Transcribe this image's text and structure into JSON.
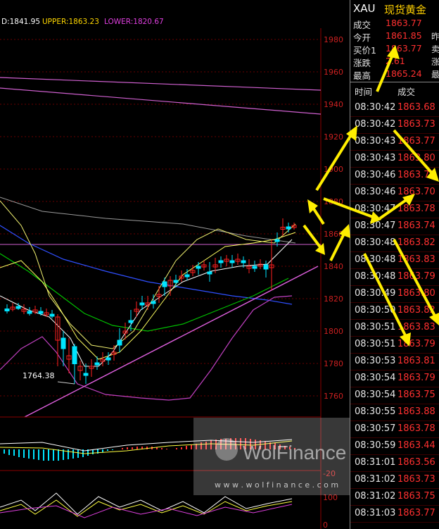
{
  "indicator": {
    "mid_label": "D:1841.95",
    "upper_label": "UPPER:1863.23",
    "lower_label": "LOWER:1820.67",
    "low_marker": "1764.38"
  },
  "axis_ticks": [
    "1980",
    "1960",
    "1940",
    "1920",
    "1900",
    "1880",
    "1860",
    "1840",
    "1820",
    "1800",
    "1780",
    "1760"
  ],
  "lower_ticks": [
    "-20",
    "100",
    "0"
  ],
  "watermark": {
    "brand": "WolFinance",
    "url": "w w w . w o l f i n a n c e . c o m"
  },
  "quote": {
    "symbol": "XAU",
    "name": "现货黄金",
    "rows": [
      {
        "label": "成交",
        "value": "1863.77",
        "edge": ""
      },
      {
        "label": "今开",
        "value": "1861.85",
        "edge": "昨"
      },
      {
        "label": "买价1",
        "value": "1863.77",
        "edge": "卖"
      },
      {
        "label": "涨跌",
        "value": "2.61",
        "edge": "涨"
      },
      {
        "label": "最高",
        "value": "1865.24",
        "edge": "最"
      }
    ]
  },
  "ticks": {
    "col_time": "时间",
    "col_price": "成交",
    "rows": [
      {
        "time": "08:30:42",
        "price": "1863.68"
      },
      {
        "time": "08:30:42",
        "price": "1863.73"
      },
      {
        "time": "08:30:43",
        "price": "1863.77"
      },
      {
        "time": "08:30:43",
        "price": "1863.80"
      },
      {
        "time": "08:30:46",
        "price": "1863.75"
      },
      {
        "time": "08:30:46",
        "price": "1863.70"
      },
      {
        "time": "08:30:47",
        "price": "1863.78"
      },
      {
        "time": "08:30:47",
        "price": "1863.74"
      },
      {
        "time": "08:30:48",
        "price": "1863.82"
      },
      {
        "time": "08:30:48",
        "price": "1863.83"
      },
      {
        "time": "08:30:48",
        "price": "1863.79"
      },
      {
        "time": "08:30:49",
        "price": "1863.80"
      },
      {
        "time": "08:30:50",
        "price": "1863.82"
      },
      {
        "time": "08:30:51",
        "price": "1863.83"
      },
      {
        "time": "08:30:51",
        "price": "1863.79"
      },
      {
        "time": "08:30:53",
        "price": "1863.81"
      },
      {
        "time": "08:30:54",
        "price": "1863.79"
      },
      {
        "time": "08:30:54",
        "price": "1863.75"
      },
      {
        "time": "08:30:55",
        "price": "1863.88"
      },
      {
        "time": "08:30:57",
        "price": "1863.78"
      },
      {
        "time": "08:30:59",
        "price": "1863.44"
      },
      {
        "time": "08:31:01",
        "price": "1863.56"
      },
      {
        "time": "08:31:02",
        "price": "1863.73"
      },
      {
        "time": "08:31:02",
        "price": "1863.75"
      },
      {
        "time": "08:31:03",
        "price": "1863.77"
      }
    ]
  },
  "colors": {
    "up": "#00e5ff",
    "down": "#ff2020",
    "accent": "#ffd000",
    "grid": "#7a0000"
  }
}
